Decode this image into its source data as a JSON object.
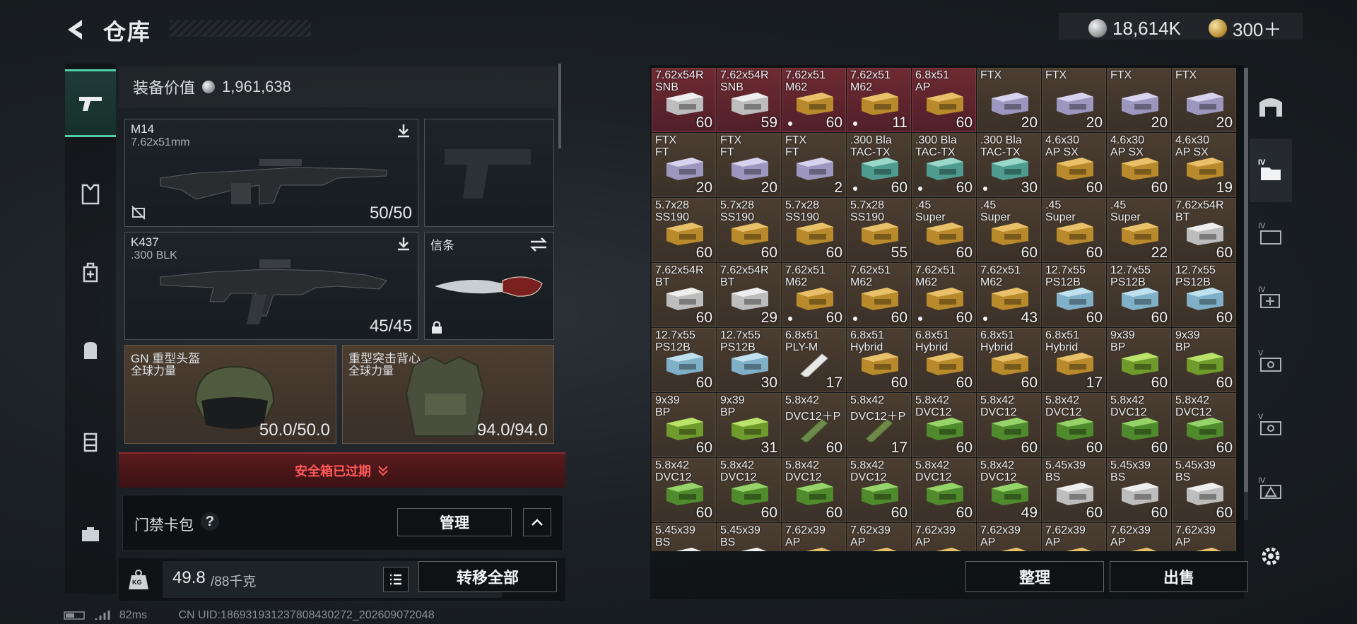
{
  "header": {
    "title": "仓库",
    "currency_a": "18,614K",
    "currency_b": "300＋"
  },
  "equipment": {
    "value_label": "装备价值",
    "value": "1,961,638",
    "primary": {
      "name": "M14",
      "caliber": "7.62x51mm",
      "ammo": "50/50"
    },
    "secondary": {
      "name": "K437",
      "caliber": ".300 BLK",
      "ammo": "45/45"
    },
    "melee": {
      "name": "信条"
    },
    "helmet": {
      "name": "GN 重型头盔",
      "brand": "全球力量",
      "durability": "50.0/50.0"
    },
    "armor": {
      "name": "重型突击背心",
      "brand": "全球力量",
      "durability": "94.0/94.0"
    },
    "safe_box_text": "安全箱已过期",
    "card_pack": {
      "label": "门禁卡包",
      "help": "?",
      "manage": "管理"
    },
    "weight": {
      "unit_icon": "KG",
      "current": "49.8",
      "max": "/88千克"
    },
    "transfer_all": "转移全部"
  },
  "inventory": {
    "cells": [
      {
        "l1": "7.62x54R",
        "l2": "SNB",
        "n": "60",
        "c": "red",
        "b": "white",
        "d": false
      },
      {
        "l1": "7.62x54R",
        "l2": "SNB",
        "n": "59",
        "c": "red",
        "b": "white",
        "d": false
      },
      {
        "l1": "7.62x51",
        "l2": "M62",
        "n": "60",
        "c": "red",
        "b": "tan",
        "d": true
      },
      {
        "l1": "7.62x51",
        "l2": "M62",
        "n": "11",
        "c": "red",
        "b": "tan",
        "d": true
      },
      {
        "l1": "6.8x51",
        "l2": "AP",
        "n": "60",
        "c": "red",
        "b": "tan",
        "d": false
      },
      {
        "l1": "FTX",
        "l2": "",
        "n": "20",
        "c": "",
        "b": "lav",
        "d": false
      },
      {
        "l1": "FTX",
        "l2": "",
        "n": "20",
        "c": "",
        "b": "lav",
        "d": false
      },
      {
        "l1": "FTX",
        "l2": "",
        "n": "20",
        "c": "",
        "b": "lav",
        "d": false
      },
      {
        "l1": "FTX",
        "l2": "",
        "n": "20",
        "c": "",
        "b": "lav",
        "d": false
      },
      {
        "l1": "FTX",
        "l2": "FT",
        "n": "20",
        "c": "",
        "b": "lav",
        "d": false
      },
      {
        "l1": "FTX",
        "l2": "FT",
        "n": "20",
        "c": "",
        "b": "lav",
        "d": false
      },
      {
        "l1": "FTX",
        "l2": "FT",
        "n": "2",
        "c": "",
        "b": "lav",
        "d": false
      },
      {
        "l1": ".300 Bla",
        "l2": "TAC-TX",
        "n": "60",
        "c": "",
        "b": "teal",
        "d": true
      },
      {
        "l1": ".300 Bla",
        "l2": "TAC-TX",
        "n": "60",
        "c": "",
        "b": "teal",
        "d": true
      },
      {
        "l1": ".300 Bla",
        "l2": "TAC-TX",
        "n": "30",
        "c": "",
        "b": "teal",
        "d": true
      },
      {
        "l1": "4.6x30",
        "l2": "AP SX",
        "n": "60",
        "c": "",
        "b": "tan",
        "d": false
      },
      {
        "l1": "4.6x30",
        "l2": "AP SX",
        "n": "60",
        "c": "",
        "b": "tan",
        "d": false
      },
      {
        "l1": "4.6x30",
        "l2": "AP SX",
        "n": "19",
        "c": "",
        "b": "tan",
        "d": false
      },
      {
        "l1": "5.7x28",
        "l2": "SS190",
        "n": "60",
        "c": "",
        "b": "tan",
        "d": false
      },
      {
        "l1": "5.7x28",
        "l2": "SS190",
        "n": "60",
        "c": "",
        "b": "tan",
        "d": false
      },
      {
        "l1": "5.7x28",
        "l2": "SS190",
        "n": "60",
        "c": "",
        "b": "tan",
        "d": false
      },
      {
        "l1": "5.7x28",
        "l2": "SS190",
        "n": "55",
        "c": "",
        "b": "tan",
        "d": false
      },
      {
        "l1": ".45",
        "l2": "Super",
        "n": "60",
        "c": "",
        "b": "tan",
        "d": false
      },
      {
        "l1": ".45",
        "l2": "Super",
        "n": "60",
        "c": "",
        "b": "tan",
        "d": false
      },
      {
        "l1": ".45",
        "l2": "Super",
        "n": "60",
        "c": "",
        "b": "tan",
        "d": false
      },
      {
        "l1": ".45",
        "l2": "Super",
        "n": "22",
        "c": "",
        "b": "tan",
        "d": false
      },
      {
        "l1": "7.62x54R",
        "l2": "BT",
        "n": "60",
        "c": "",
        "b": "white",
        "d": false
      },
      {
        "l1": "7.62x54R",
        "l2": "BT",
        "n": "60",
        "c": "",
        "b": "white",
        "d": false
      },
      {
        "l1": "7.62x54R",
        "l2": "BT",
        "n": "29",
        "c": "",
        "b": "white",
        "d": false
      },
      {
        "l1": "7.62x51",
        "l2": "M62",
        "n": "60",
        "c": "",
        "b": "tan",
        "d": true
      },
      {
        "l1": "7.62x51",
        "l2": "M62",
        "n": "60",
        "c": "",
        "b": "tan",
        "d": true
      },
      {
        "l1": "7.62x51",
        "l2": "M62",
        "n": "60",
        "c": "",
        "b": "tan",
        "d": true
      },
      {
        "l1": "7.62x51",
        "l2": "M62",
        "n": "43",
        "c": "",
        "b": "tan",
        "d": true
      },
      {
        "l1": "12.7x55",
        "l2": "PS12B",
        "n": "60",
        "c": "",
        "b": "blue",
        "d": false
      },
      {
        "l1": "12.7x55",
        "l2": "PS12B",
        "n": "60",
        "c": "",
        "b": "blue",
        "d": false
      },
      {
        "l1": "12.7x55",
        "l2": "PS12B",
        "n": "60",
        "c": "",
        "b": "blue",
        "d": false
      },
      {
        "l1": "12.7x55",
        "l2": "PS12B",
        "n": "60",
        "c": "",
        "b": "blue",
        "d": false
      },
      {
        "l1": "12.7x55",
        "l2": "PS12B",
        "n": "30",
        "c": "",
        "b": "blue",
        "d": false
      },
      {
        "l1": "6.8x51",
        "l2": "PLY-M",
        "n": "17",
        "c": "",
        "b": "shell",
        "d": false
      },
      {
        "l1": "6.8x51",
        "l2": "Hybrid",
        "n": "60",
        "c": "",
        "b": "tan",
        "d": false
      },
      {
        "l1": "6.8x51",
        "l2": "Hybrid",
        "n": "60",
        "c": "",
        "b": "tan",
        "d": false
      },
      {
        "l1": "6.8x51",
        "l2": "Hybrid",
        "n": "60",
        "c": "",
        "b": "tan",
        "d": false
      },
      {
        "l1": "6.8x51",
        "l2": "Hybrid",
        "n": "17",
        "c": "",
        "b": "tan",
        "d": false
      },
      {
        "l1": "9x39",
        "l2": "BP",
        "n": "60",
        "c": "",
        "b": "lime",
        "d": false
      },
      {
        "l1": "9x39",
        "l2": "BP",
        "n": "60",
        "c": "",
        "b": "lime",
        "d": false
      },
      {
        "l1": "9x39",
        "l2": "BP",
        "n": "60",
        "c": "",
        "b": "lime",
        "d": false
      },
      {
        "l1": "9x39",
        "l2": "BP",
        "n": "31",
        "c": "",
        "b": "lime",
        "d": false
      },
      {
        "l1": "5.8x42",
        "l2": "DVC12＋P",
        "n": "60",
        "c": "",
        "b": "shell2",
        "d": false
      },
      {
        "l1": "5.8x42",
        "l2": "DVC12＋P",
        "n": "17",
        "c": "",
        "b": "shell2",
        "d": false
      },
      {
        "l1": "5.8x42",
        "l2": "DVC12",
        "n": "60",
        "c": "",
        "b": "green",
        "d": false
      },
      {
        "l1": "5.8x42",
        "l2": "DVC12",
        "n": "60",
        "c": "",
        "b": "green",
        "d": false
      },
      {
        "l1": "5.8x42",
        "l2": "DVC12",
        "n": "60",
        "c": "",
        "b": "green",
        "d": false
      },
      {
        "l1": "5.8x42",
        "l2": "DVC12",
        "n": "60",
        "c": "",
        "b": "green",
        "d": false
      },
      {
        "l1": "5.8x42",
        "l2": "DVC12",
        "n": "60",
        "c": "",
        "b": "green",
        "d": false
      },
      {
        "l1": "5.8x42",
        "l2": "DVC12",
        "n": "60",
        "c": "",
        "b": "green",
        "d": false
      },
      {
        "l1": "5.8x42",
        "l2": "DVC12",
        "n": "60",
        "c": "",
        "b": "green",
        "d": false
      },
      {
        "l1": "5.8x42",
        "l2": "DVC12",
        "n": "60",
        "c": "",
        "b": "green",
        "d": false
      },
      {
        "l1": "5.8x42",
        "l2": "DVC12",
        "n": "60",
        "c": "",
        "b": "green",
        "d": false
      },
      {
        "l1": "5.8x42",
        "l2": "DVC12",
        "n": "60",
        "c": "",
        "b": "green",
        "d": false
      },
      {
        "l1": "5.8x42",
        "l2": "DVC12",
        "n": "49",
        "c": "",
        "b": "green",
        "d": false
      },
      {
        "l1": "5.45x39",
        "l2": "BS",
        "n": "60",
        "c": "",
        "b": "white",
        "d": false
      },
      {
        "l1": "5.45x39",
        "l2": "BS",
        "n": "60",
        "c": "",
        "b": "white",
        "d": false
      },
      {
        "l1": "5.45x39",
        "l2": "BS",
        "n": "60",
        "c": "",
        "b": "white",
        "d": false
      },
      {
        "l1": "5.45x39",
        "l2": "BS",
        "n": "",
        "c": "",
        "b": "white",
        "d": false
      },
      {
        "l1": "5.45x39",
        "l2": "BS",
        "n": "",
        "c": "",
        "b": "white",
        "d": false
      },
      {
        "l1": "7.62x39",
        "l2": "AP",
        "n": "",
        "c": "",
        "b": "tan",
        "d": false
      },
      {
        "l1": "7.62x39",
        "l2": "AP",
        "n": "",
        "c": "",
        "b": "tan",
        "d": false
      },
      {
        "l1": "7.62x39",
        "l2": "AP",
        "n": "",
        "c": "",
        "b": "tan",
        "d": false
      },
      {
        "l1": "7.62x39",
        "l2": "AP",
        "n": "",
        "c": "",
        "b": "tan",
        "d": false
      },
      {
        "l1": "7.62x39",
        "l2": "AP",
        "n": "",
        "c": "",
        "b": "tan",
        "d": false
      },
      {
        "l1": "7.62x39",
        "l2": "AP",
        "n": "",
        "c": "",
        "b": "tan",
        "d": false
      },
      {
        "l1": "7.62x39",
        "l2": "AP",
        "n": "",
        "c": "",
        "b": "tan",
        "d": false
      }
    ],
    "sort_button": "整理",
    "sell_button": "出售"
  },
  "footer": {
    "ping": "82ms",
    "uid": "CN UID:1869319312378084302​72_202609072048"
  },
  "colors": {
    "accent": "#4fd0a8",
    "expired": "#ff5a5a"
  }
}
